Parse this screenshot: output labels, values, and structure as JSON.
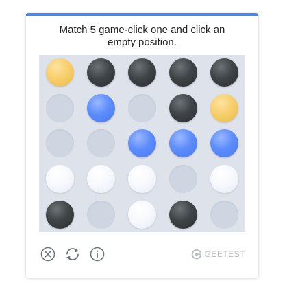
{
  "captcha": {
    "prompt": "Match 5 game-click one and click an empty position.",
    "accent_color": "#4a84f7",
    "board": [
      [
        "yellow",
        "dark",
        "dark",
        "dark",
        "dark"
      ],
      [
        "empty",
        "blue",
        "empty",
        "dark",
        "yellow"
      ],
      [
        "empty",
        "empty",
        "blue",
        "blue",
        "blue"
      ],
      [
        "white",
        "white",
        "white",
        "empty",
        "white"
      ],
      [
        "dark",
        "empty",
        "white",
        "dark",
        "empty"
      ]
    ],
    "toolbar": {
      "close_icon": "close-icon",
      "refresh_icon": "refresh-icon",
      "info_icon": "info-icon"
    },
    "brand": {
      "text": "GEETEST",
      "logo_icon": "geetest-logo-icon"
    }
  }
}
